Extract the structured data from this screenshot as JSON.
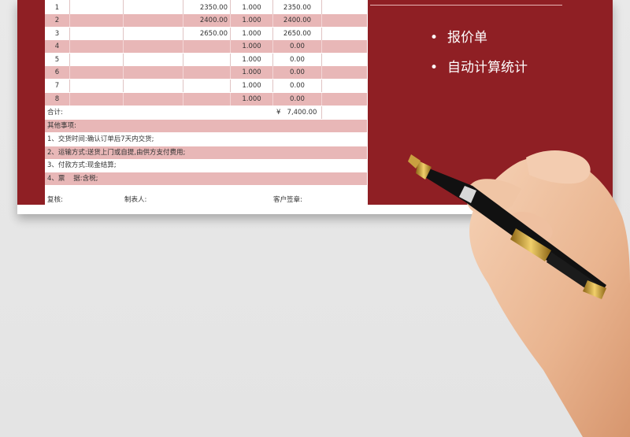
{
  "panel": {
    "bullets": [
      "报价单",
      "自动计算统计"
    ],
    "bullet_glyph": "•"
  },
  "table": {
    "rows": [
      {
        "no": "1",
        "price": "2350.00",
        "qty": "1.000",
        "amount": "2350.00"
      },
      {
        "no": "2",
        "price": "2400.00",
        "qty": "1.000",
        "amount": "2400.00"
      },
      {
        "no": "3",
        "price": "2650.00",
        "qty": "1.000",
        "amount": "2650.00"
      },
      {
        "no": "4",
        "price": "",
        "qty": "1.000",
        "amount": "0.00"
      },
      {
        "no": "5",
        "price": "",
        "qty": "1.000",
        "amount": "0.00"
      },
      {
        "no": "6",
        "price": "",
        "qty": "1.000",
        "amount": "0.00"
      },
      {
        "no": "7",
        "price": "",
        "qty": "1.000",
        "amount": "0.00"
      },
      {
        "no": "8",
        "price": "",
        "qty": "1.000",
        "amount": "0.00"
      }
    ],
    "total_label": "合计:",
    "total_currency": "¥",
    "total_value": "7,400.00"
  },
  "notes": {
    "heading": "其他事项:",
    "items": [
      "1、交货时间:确认订单后7天内交货;",
      "2、运输方式:送货上门或自提,由供方支付费用;",
      "3、付款方式:现金结算;",
      "4、票    据:含税;"
    ]
  },
  "signatures": {
    "review": "复核:",
    "maker": "制表人:",
    "customer": "客户签章:"
  },
  "colors": {
    "panel": "#8f1f24",
    "row_pink": "#e8b7b7"
  }
}
